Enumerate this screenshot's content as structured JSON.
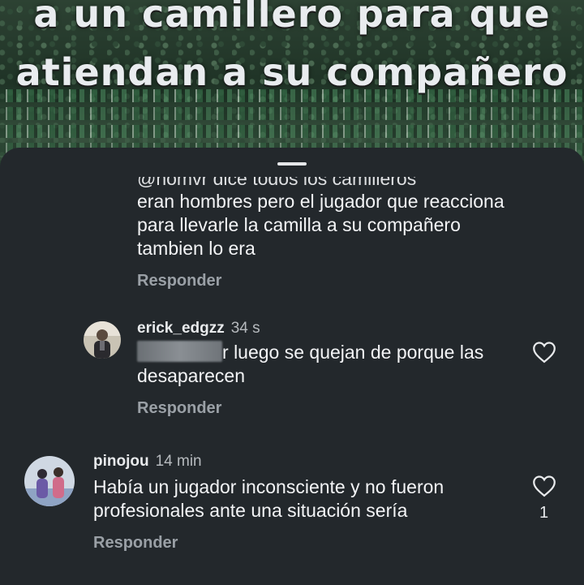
{
  "video": {
    "caption_line1": "a un camillero para que",
    "caption_line2": "atiendan a su compañero"
  },
  "comments": [
    {
      "partial_top_text": "@nomvr dice todos los camilleros",
      "text": "eran hombres pero el jugador que reacciona para llevarle la camilla a su compañero tambien lo era",
      "reply_label": "Responder"
    },
    {
      "username": "erick_edgzz",
      "time": "34 s",
      "mention_suffix": "r",
      "text": "luego se quejan de porque las desaparecen",
      "reply_label": "Responder"
    },
    {
      "username": "pinojou",
      "time": "14 min",
      "text": "Había un jugador inconsciente y no fueron profesionales ante una situación sería",
      "like_count": "1",
      "reply_label": "Responder"
    }
  ],
  "colors": {
    "sheet_bg": "#23282c",
    "text_primary": "#f3f4f6",
    "text_secondary": "#9aa0a6"
  },
  "icons": [
    "heart-icon",
    "sheet-handle"
  ]
}
